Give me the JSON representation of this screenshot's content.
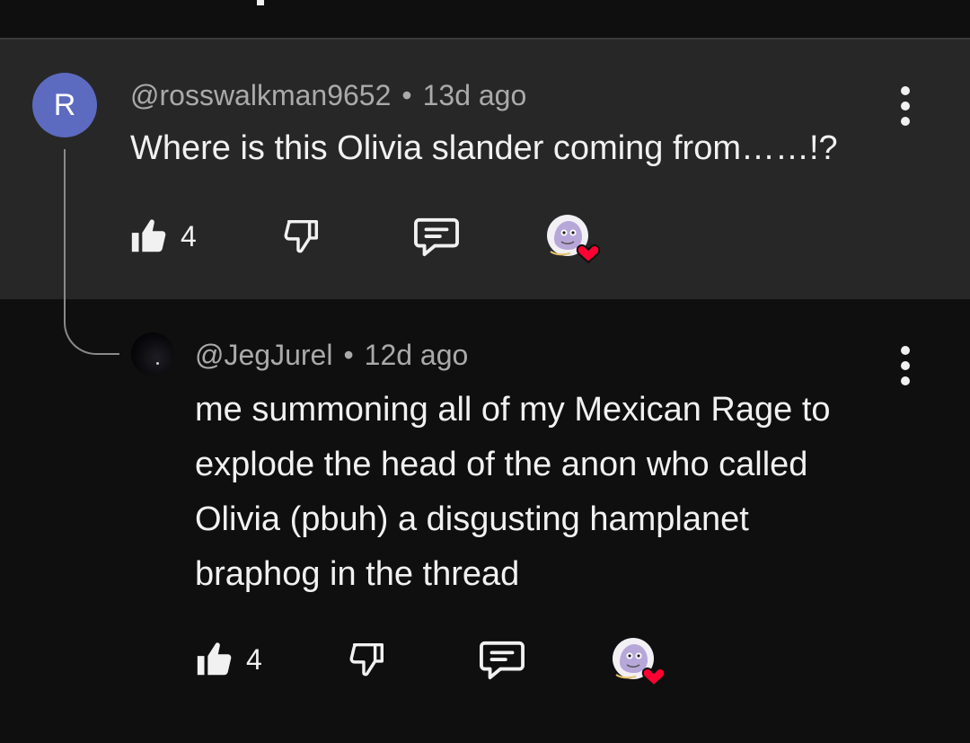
{
  "comments": [
    {
      "avatar_letter": "R",
      "avatar_color": "#5c6bc0",
      "handle": "@rosswalkman9652",
      "separator": "•",
      "age": "13d ago",
      "text": "Where is this Olivia slander coming from……!?",
      "likes": "4"
    },
    {
      "handle": "@JegJurel",
      "separator": "•",
      "age": "12d ago",
      "text_lines": [
        "me summoning all of my Mexican Rage to",
        "explode the head of the anon who called",
        "Olivia (pbuh) a disgusting hamplanet",
        "braphog in the thread"
      ],
      "likes": "4"
    }
  ],
  "icons": {
    "like": "thumbs-up-icon",
    "dislike": "thumbs-down-icon",
    "reply": "reply-comment-icon",
    "creator_heart": "creator-heart-badge",
    "menu": "more-vertical-icon"
  },
  "colors": {
    "background": "#0f0f0f",
    "highlight_background": "#272727",
    "heart": "#ff0033",
    "meta_text": "#aaaaaa"
  }
}
